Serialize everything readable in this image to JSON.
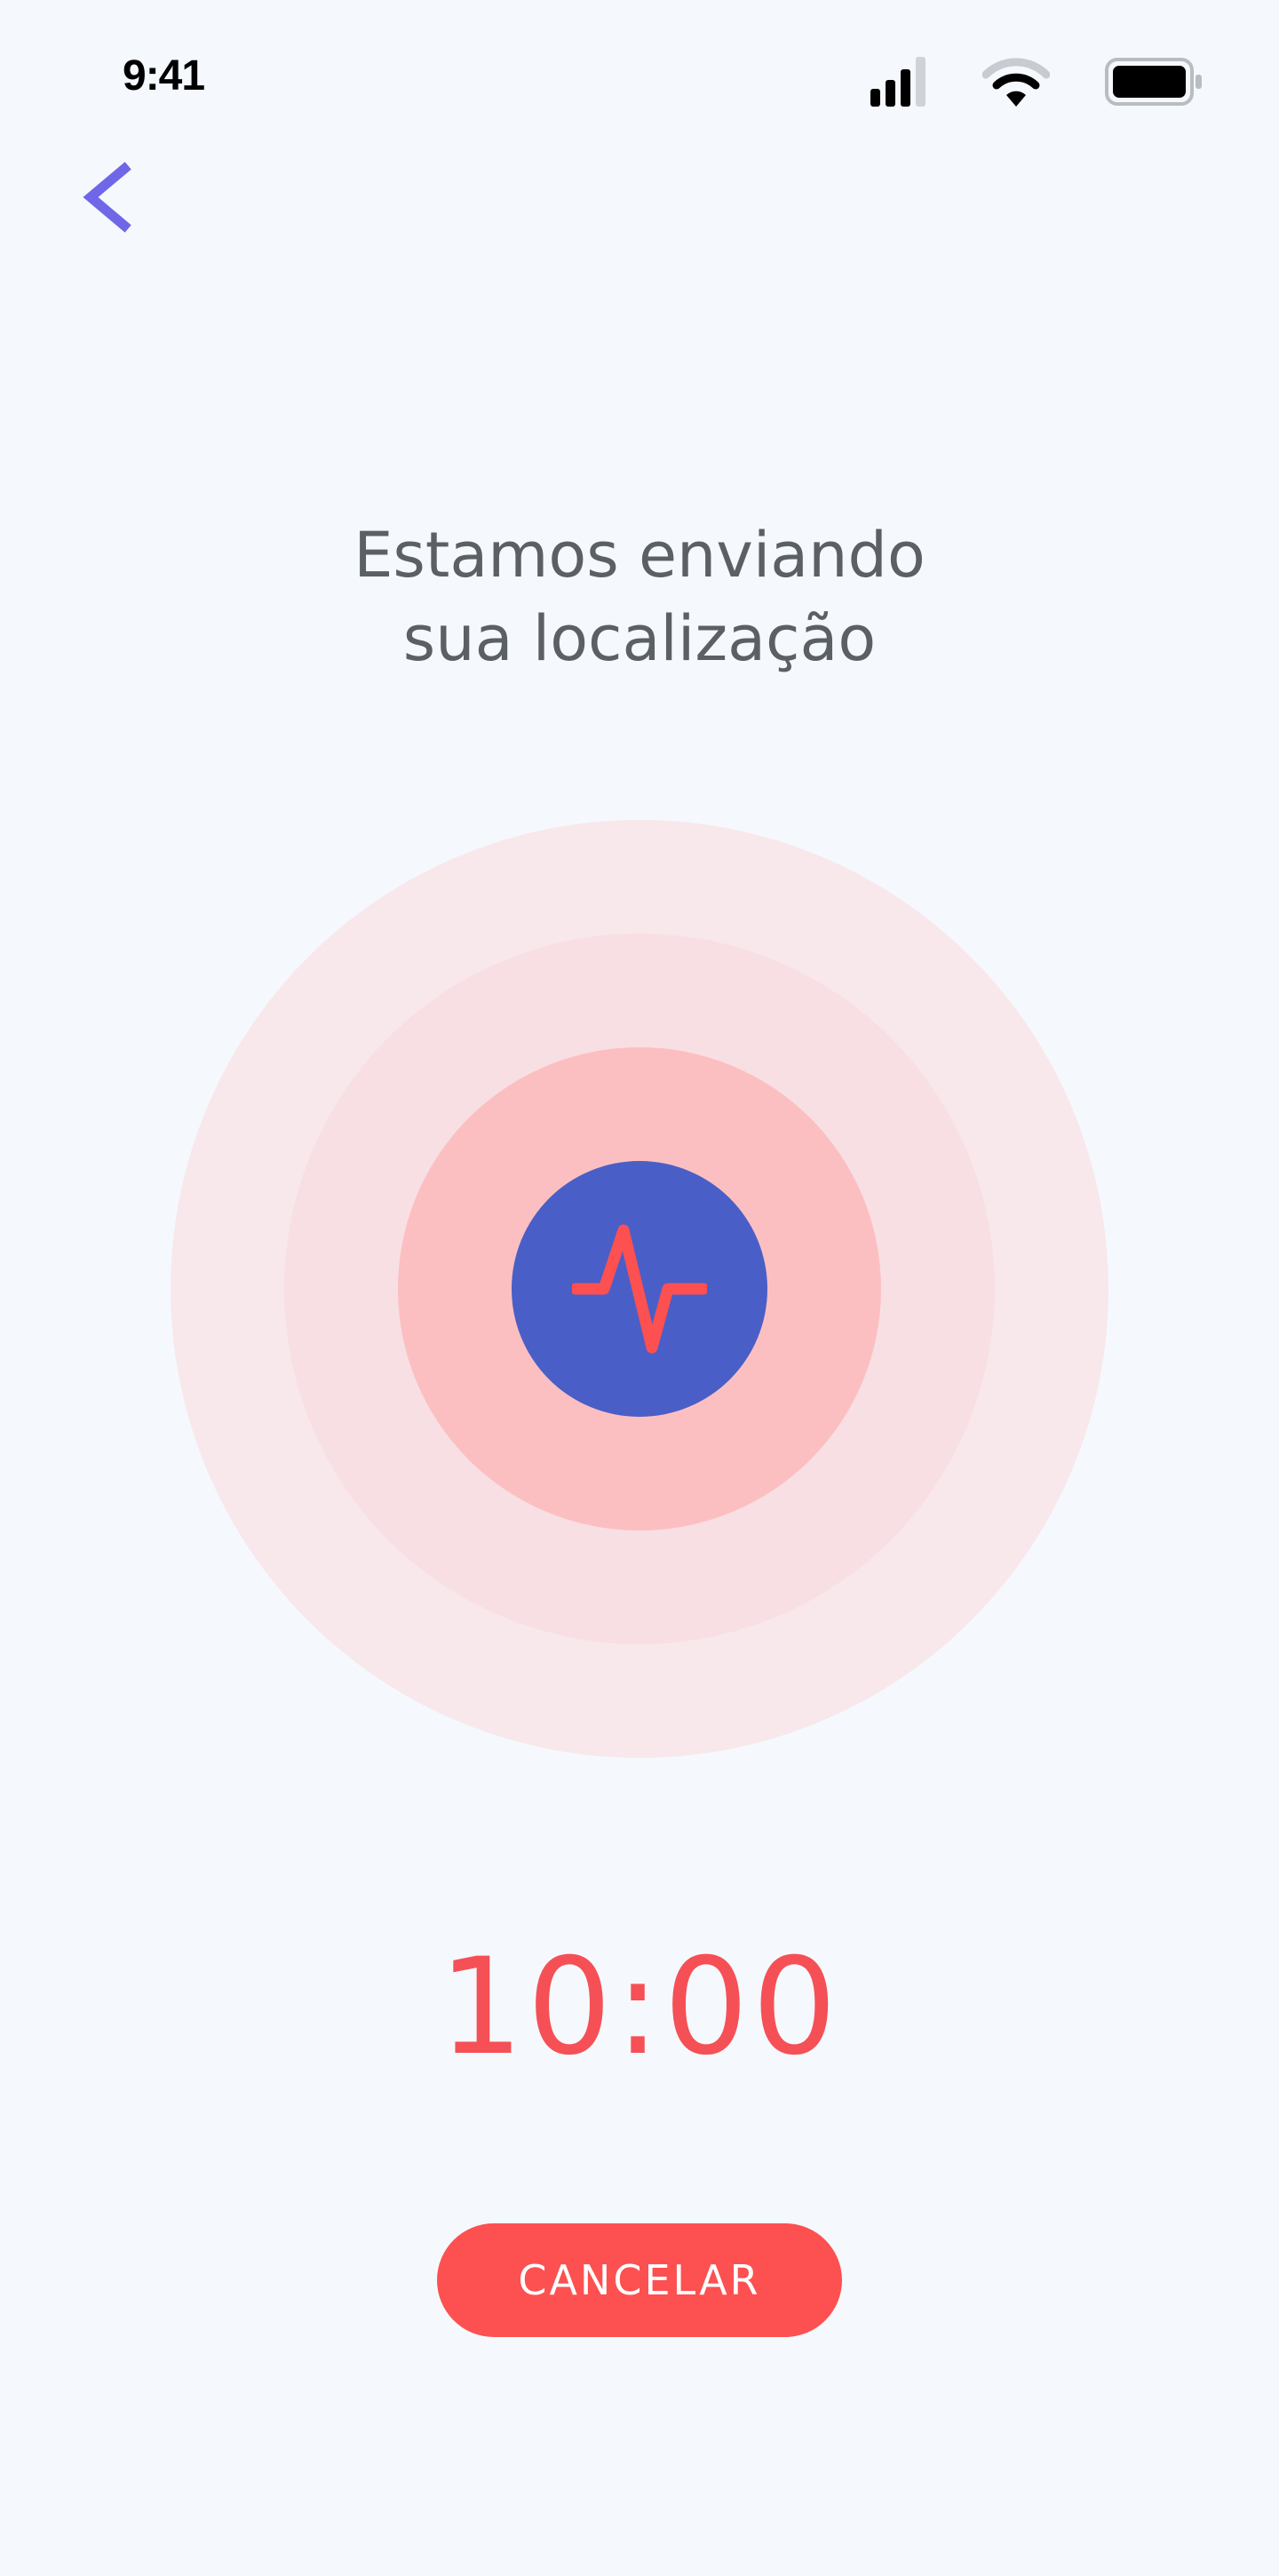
{
  "status_bar": {
    "time": "9:41",
    "icons": [
      "signal-icon",
      "wifi-icon",
      "battery-icon"
    ]
  },
  "nav": {
    "back_icon": "chevron-left-icon"
  },
  "title": {
    "line1": "Estamos enviando",
    "line2": "sua localização"
  },
  "pulse": {
    "icon": "activity-icon"
  },
  "timer": {
    "value": "10:00"
  },
  "actions": {
    "cancel_label": "CANCELAR"
  },
  "colors": {
    "background": "#f5f9fd",
    "accent": "#6f66e8",
    "alert": "#fd5050",
    "core": "#4a5ec7",
    "ring_outer": "#f8e8ec",
    "ring_middle": "#f8dfe3",
    "ring_inner": "#fcbfc1",
    "title_text": "#5b6064"
  }
}
